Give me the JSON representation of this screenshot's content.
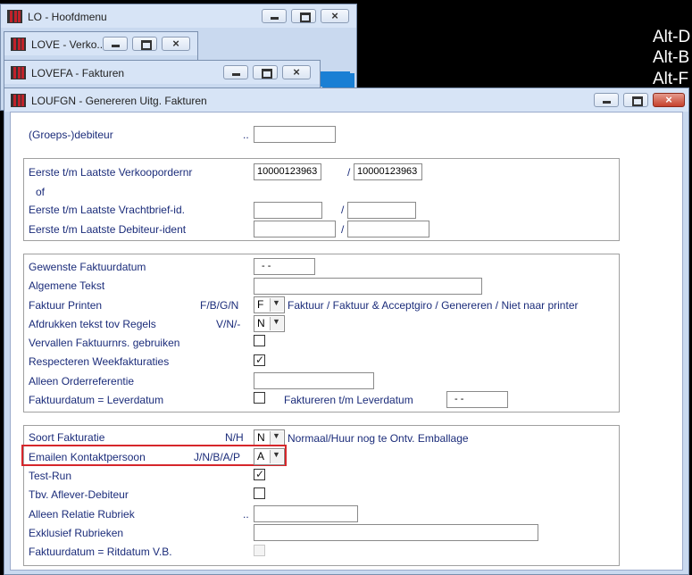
{
  "background_windows": [
    {
      "title": "LO - Hoofdmenu",
      "buttons": {
        "min": "minimize-button",
        "max": "maximize-button",
        "close": "×"
      }
    },
    {
      "title": "LOVE - Verko...",
      "buttons": {
        "close": "×"
      }
    },
    {
      "title": "LOVEFA - Fakturen",
      "buttons": {
        "close": "×"
      }
    }
  ],
  "side_text": [
    "Alt-D",
    "Alt-B",
    "Alt-F"
  ],
  "main_window": {
    "title": "LOUFGN - Genereren Uitg. Fakturen",
    "close_glyph": "×"
  },
  "form": {
    "groeps_debiteur": {
      "label": "(Groeps-)debiteur",
      "dots": "..",
      "value": ""
    },
    "group1": {
      "verkooporder_label": "Eerste t/m Laatste Verkoopordernr",
      "verkooporder_from": "10000123963",
      "verkooporder_to": "10000123963",
      "sep": "/",
      "of_label": "of",
      "vrachtbrief_label": "Eerste t/m Laatste Vrachtbrief-id.",
      "vrachtbrief_from": "",
      "vrachtbrief_to": "",
      "debiteur_label": "Eerste t/m Laatste Debiteur-ident",
      "debiteur_from": "",
      "debiteur_to": ""
    },
    "group2": {
      "faktuurdatum_label": "Gewenste Faktuurdatum",
      "faktuurdatum_value": "- -",
      "algemene_tekst_label": "Algemene Tekst",
      "algemene_tekst_value": "",
      "faktuur_printen_label": "Faktuur Printen",
      "faktuur_printen_codes": "F/B/G/N",
      "faktuur_printen_value": "F",
      "faktuur_printen_desc": "Faktuur / Faktuur & Acceptgiro / Genereren / Niet naar printer",
      "afdrukken_label": "Afdrukken tekst tov Regels",
      "afdrukken_codes": "V/N/-",
      "afdrukken_value": "N",
      "vervallen_label": "Vervallen Faktuurnrs. gebruiken",
      "vervallen_checked": false,
      "weekfakturaties_label": "Respecteren Weekfakturaties",
      "weekfakturaties_checked": true,
      "orderreferentie_label": "Alleen Orderreferentie",
      "orderreferentie_value": "",
      "leverdatum_label": "Faktuurdatum = Leverdatum",
      "leverdatum_checked": false,
      "factureren_tm_label": "Faktureren t/m Leverdatum",
      "factureren_tm_value": "- -"
    },
    "group3": {
      "soort_label": "Soort Fakturatie",
      "soort_codes": "N/H",
      "soort_value": "N",
      "soort_desc": "Normaal/Huur nog te Ontv. Emballage",
      "emailen_label": "Emailen Kontaktpersoon",
      "emailen_codes": "J/N/B/A/P",
      "emailen_value": "A",
      "testrun_label": "Test-Run",
      "testrun_checked": true,
      "aflever_label": "Tbv. Aflever-Debiteur",
      "aflever_checked": false,
      "relatie_label": "Alleen Relatie Rubriek",
      "relatie_dots": "..",
      "relatie_value": "",
      "exklusief_label": "Exklusief Rubrieken",
      "exklusief_value": "",
      "ritdatum_label": "Faktuurdatum = Ritdatum V.B.",
      "ritdatum_checked": false
    }
  },
  "colors": {
    "label": "#1b2c7a",
    "highlight": "#d6262b",
    "client": "#ffffff"
  }
}
